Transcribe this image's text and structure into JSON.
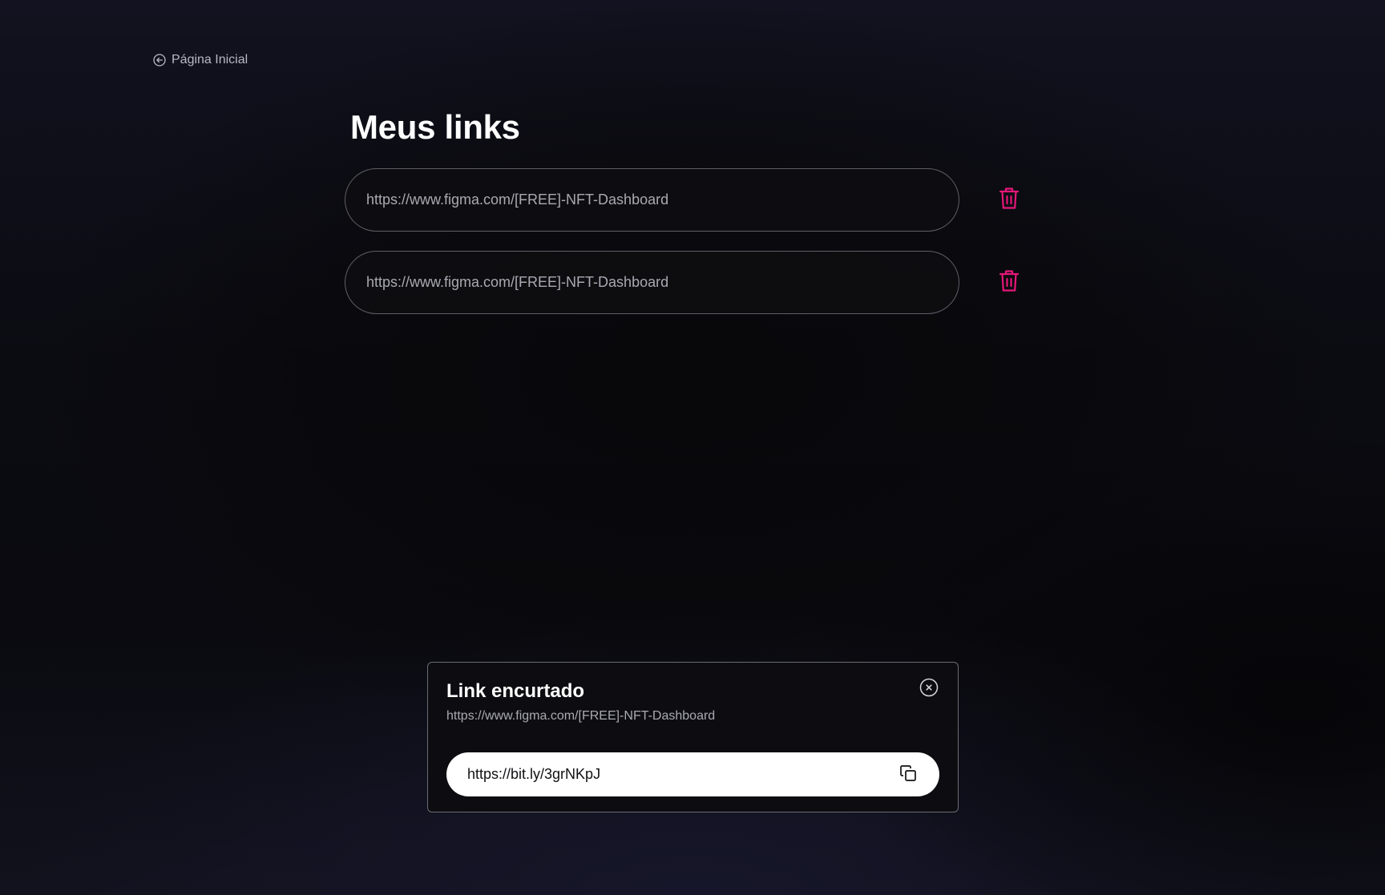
{
  "nav": {
    "back_label": "Página Inicial",
    "back_icon": "arrow-left-circle-icon"
  },
  "page": {
    "title": "Meus links"
  },
  "links": [
    {
      "url": "https://www.figma.com/[FREE]-NFT-Dashboard",
      "delete_icon": "trash-icon"
    },
    {
      "url": "https://www.figma.com/[FREE]-NFT-Dashboard",
      "delete_icon": "trash-icon"
    }
  ],
  "modal": {
    "title": "Link encurtado",
    "original_url": "https://www.figma.com/[FREE]-NFT-Dashboard",
    "short_url": "https://bit.ly/3grNKpJ",
    "close_icon": "close-circle-icon",
    "copy_icon": "copy-icon"
  },
  "colors": {
    "accent": "#e6177a",
    "background": "#0b0b12",
    "border": "#5e5e66",
    "muted_text": "#a9a9b2"
  }
}
